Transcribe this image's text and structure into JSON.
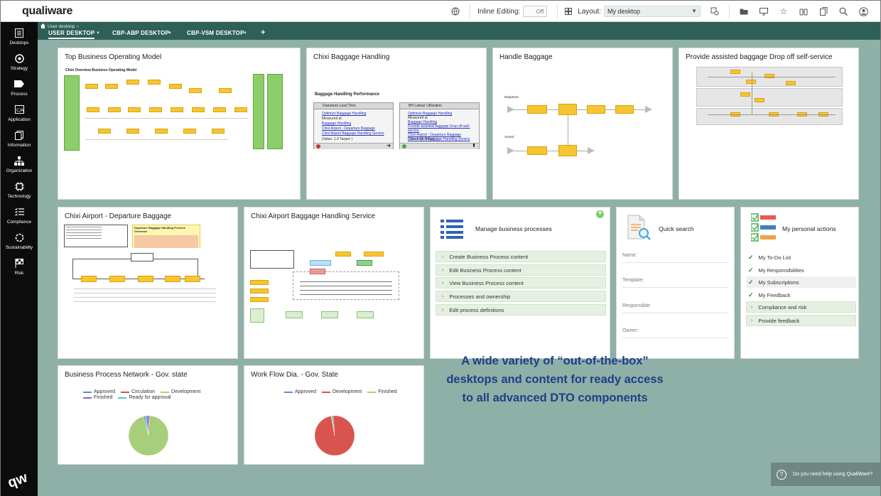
{
  "topbar": {
    "logo": "qualiware",
    "inline_editing_label": "Inline Editing:",
    "inline_editing_value": "Off",
    "layout_label": "Layout:",
    "layout_value": "My desktop"
  },
  "sidebar": {
    "items": [
      {
        "label": "Desktops",
        "icon": "desktops-icon"
      },
      {
        "label": "Strategy",
        "icon": "strategy-icon"
      },
      {
        "label": "Process",
        "icon": "process-icon"
      },
      {
        "label": "Application",
        "icon": "application-icon"
      },
      {
        "label": "Information",
        "icon": "information-icon"
      },
      {
        "label": "Organization",
        "icon": "organization-icon"
      },
      {
        "label": "Technology",
        "icon": "technology-icon"
      },
      {
        "label": "Compliance",
        "icon": "compliance-icon"
      },
      {
        "label": "Sustainability",
        "icon": "sustainability-icon"
      },
      {
        "label": "Risk",
        "icon": "risk-icon"
      }
    ],
    "bottom_logo": "qw"
  },
  "breadcrumb": "User desktop",
  "tabs": [
    {
      "label": "USER DESKTOP",
      "active": true
    },
    {
      "label": "CBP-ABP DESKTOP",
      "active": false
    },
    {
      "label": "CBP-VSM DESKTOP",
      "active": false
    },
    {
      "label": "+",
      "active": false
    }
  ],
  "cards": {
    "top_bom": {
      "title": "Top Business Operating Model",
      "subtitle": "Chixi Overview Business Operating Model"
    },
    "baggage_handling": {
      "title": "Chixi Baggage Handling",
      "perf_title": "Baggage Handling Performance",
      "panel1": {
        "title": "Departure Lead Time",
        "links": [
          "Optimize Baggage Handling",
          "Measured at",
          "Baggage Handling",
          "Chixi Airport - Departure Baggage",
          "Chixi Airport Baggage Handling Service"
        ],
        "value": "(Value: 1.4 Target: )"
      },
      "panel2": {
        "title": "BH Labour Utilization",
        "links": [
          "Optimize Baggage Handling",
          "Measured at",
          "Baggage Handling",
          "Provide assisted baggage Drop off self-service",
          "Chixi Airport - Departure Baggage",
          "Chixi Airport Baggage Handling Service"
        ],
        "value": "(Value: 95 Target: )"
      }
    },
    "handle_baggage": {
      "title": "Handle Baggage",
      "lane1": "Departure",
      "lane2": "Arrival"
    },
    "provide_assisted": {
      "title": "Provide assisted baggage Drop off self-service"
    },
    "departure_baggage": {
      "title": "Chixi Airport - Departure Baggage",
      "note_title": "Departure Baggage Handling Process Overview"
    },
    "bh_service": {
      "title": "Chixi Airport Baggage Handling Service"
    },
    "manage_bp": {
      "title": "Manage business processes",
      "items": [
        "Create Business Process content",
        "Edit Business Process content",
        "View Business Process content",
        "Processes and ownership",
        "Edit process definitions"
      ]
    },
    "quick_search": {
      "title": "Quick search",
      "fields": [
        "Name:",
        "Template:",
        "Responsible:",
        "Owner:"
      ]
    },
    "personal_actions": {
      "title": "My personal actions",
      "checks": [
        "My To-Do List",
        "My Responsibilities",
        "My Subscriptions",
        "My Feedback"
      ],
      "links": [
        "Compliance and risk",
        "Provide feedback"
      ]
    },
    "bpn_gov": {
      "title": "Business Process Network - Gov. state"
    },
    "wf_gov": {
      "title": "Work Flow Dia. - Gov. State"
    }
  },
  "chart_data": [
    {
      "type": "pie",
      "series": [
        {
          "name": "Approved",
          "color": "#5b8fc7"
        },
        {
          "name": "Circulation",
          "color": "#d9534f"
        },
        {
          "name": "Development",
          "color": "#a7cf7b"
        },
        {
          "name": "Finished",
          "color": "#7c6fb1"
        },
        {
          "name": "Ready for approval",
          "color": "#5bc0de"
        }
      ],
      "values": [
        2,
        1,
        95,
        1,
        1
      ]
    },
    {
      "type": "pie",
      "series": [
        {
          "name": "Approved",
          "color": "#5b8fc7"
        },
        {
          "name": "Development",
          "color": "#d9534f"
        },
        {
          "name": "Finished",
          "color": "#a7cf7b"
        }
      ],
      "values": [
        1,
        98,
        1
      ]
    }
  ],
  "promo": {
    "line1": "A wide variety of “out-of-the-box”",
    "line2": "desktops and content for ready access",
    "line3": "to all advanced DTO components"
  },
  "help": {
    "text": "Do you need help using QualiWare?"
  }
}
